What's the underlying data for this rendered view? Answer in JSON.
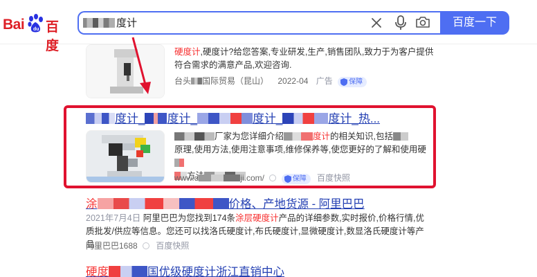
{
  "header": {
    "logo": {
      "text_en": "Bai",
      "text_cn": "百度"
    },
    "search": {
      "query_suffix": "度计"
    },
    "search_button": "百度一下"
  },
  "results": [
    {
      "desc_red": "硬度计",
      "desc_rest": ",硬度计?给您答案,专业研发,生产,销售团队,致力于为客户提供符合需求的满意产品,欢迎咨询.",
      "source_prefix": "台头",
      "source_suffix": "国际贸易（昆山）",
      "date": "2022-04",
      "ad_label": "广告",
      "badge": "保障"
    },
    {
      "title_visible_1": "度计_",
      "title_visible_2": "度计_",
      "title_visible_3": "度计_",
      "title_visible_4": "度计_热...",
      "desc_line1_a": "厂家为您详细介绍",
      "desc_line1_red": "度计",
      "desc_line1_b": "的相关知识,包括",
      "desc_line2": "原理,使用方法,使用注意事项,维修保养等,使您更好的了解和使用",
      "desc_line2_end": "硬",
      "desc_line3": "方法",
      "url_prefix": "www.d",
      "url_suffix": "ji.com/",
      "badge": "保障",
      "cache": "百度快照"
    },
    {
      "title_prefix": "涂",
      "title_suffix": "价格、产地货源 - 阿里巴巴",
      "date": "2021年7月4日",
      "desc_a": "阿里巴巴为您找到174条",
      "desc_red": "涂层硬度计",
      "desc_b": "产品的详细参数,实时报价,价格行情,优质批发/供应等信息。您还可以找洛氏硬度计,布氏硬度计,显微硬度计,数显洛氏硬度计等产品...",
      "source": "阿里巴巴1688",
      "cache": "百度快照"
    },
    {
      "title_prefix": "硬度",
      "title_suffix": "国优级硬度计浙江直销中心"
    }
  ],
  "colors": {
    "accent": "#4e6ef2",
    "title_link": "#2440b3",
    "highlight": "#f73131",
    "box": "#e0122f",
    "arrow": "#e0122f"
  }
}
